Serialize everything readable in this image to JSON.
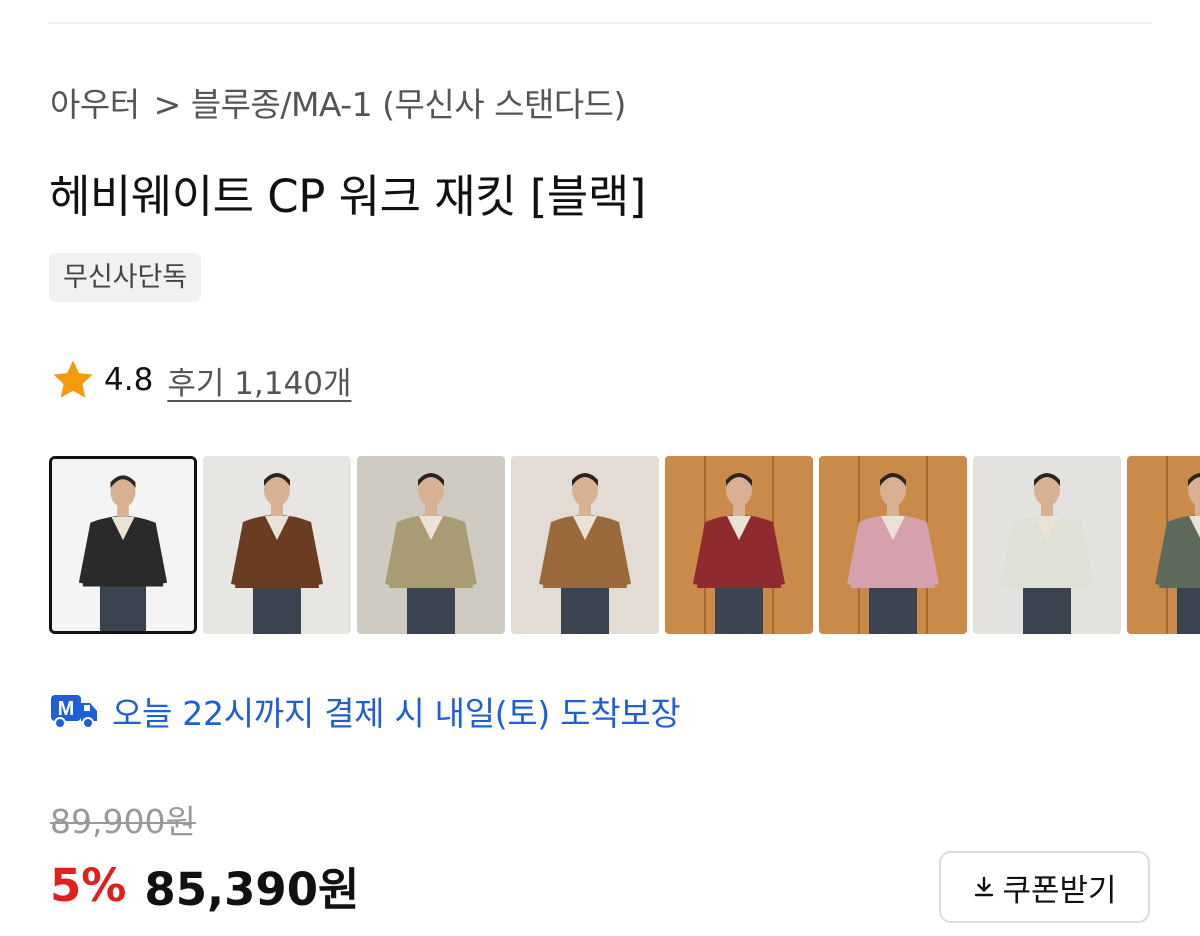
{
  "breadcrumb": {
    "category": "아우터",
    "separator": ">",
    "subcategory": "블루종/MA-1 (무신사 스탠다드)"
  },
  "product": {
    "title": "헤비웨이트 CP 워크 재킷 [블랙]",
    "badge": "무신사단독"
  },
  "rating": {
    "icon": "star-icon",
    "score": "4.8",
    "reviews_label": "후기 1,140개"
  },
  "thumbnails": [
    {
      "name": "thumbnail-black-jacket",
      "jacket_color": "#2a2a2a",
      "bg": "#f4f4f4"
    },
    {
      "name": "thumbnail-brown-jacket",
      "jacket_color": "#6b3b22",
      "bg": "#e8e6e3"
    },
    {
      "name": "thumbnail-khaki-jacket",
      "jacket_color": "#a99c74",
      "bg": "#cfcac2"
    },
    {
      "name": "thumbnail-tan-jacket",
      "jacket_color": "#9a6a3c",
      "bg": "#e2dcd4"
    },
    {
      "name": "thumbnail-red-jacket",
      "jacket_color": "#8e2a30",
      "bg": "#c98a4a"
    },
    {
      "name": "thumbnail-pink-jacket",
      "jacket_color": "#d5a1ad",
      "bg": "#c98a4a"
    },
    {
      "name": "thumbnail-ivory-jacket",
      "jacket_color": "#dfe0d6",
      "bg": "#e4e2de"
    },
    {
      "name": "thumbnail-green-jacket",
      "jacket_color": "#5e6b5c",
      "bg": "#c98a4a"
    }
  ],
  "delivery": {
    "icon": "m-delivery-truck-icon",
    "text": "오늘 22시까지 결제 시 내일(토) 도착보장"
  },
  "pricing": {
    "original_price": "89,900원",
    "discount": "5%",
    "sale_price": "85,390원"
  },
  "coupon": {
    "icon": "download-icon",
    "label": "쿠폰받기"
  },
  "colors": {
    "accent_blue": "#1f5fd6",
    "discount_red": "#e0201d",
    "star_orange": "#f59a0c"
  }
}
